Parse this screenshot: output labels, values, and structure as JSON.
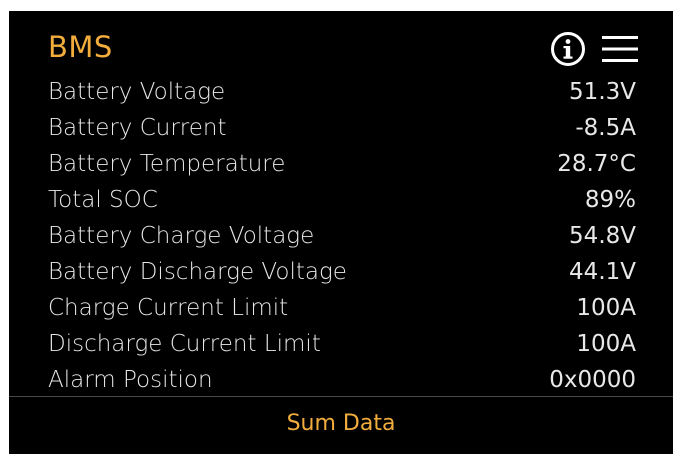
{
  "header": {
    "title": "BMS",
    "info_icon": "info-circle-icon",
    "menu_icon": "hamburger-menu-icon"
  },
  "rows": [
    {
      "label": "Battery Voltage",
      "value": "51.3V"
    },
    {
      "label": "Battery Current",
      "value": "-8.5A"
    },
    {
      "label": "Battery Temperature",
      "value": "28.7°C"
    },
    {
      "label": "Total SOC",
      "value": "89%"
    },
    {
      "label": "Battery Charge Voltage",
      "value": "54.8V"
    },
    {
      "label": "Battery Discharge Voltage",
      "value": "44.1V"
    },
    {
      "label": "Charge Current Limit",
      "value": "100A"
    },
    {
      "label": "Discharge Current Limit",
      "value": "100A"
    },
    {
      "label": "Alarm Position",
      "value": "0x0000"
    }
  ],
  "footer": {
    "button_label": "Sum Data"
  },
  "colors": {
    "accent": "#f2ad3d",
    "background": "#000000",
    "text": "#e8e8e8"
  }
}
